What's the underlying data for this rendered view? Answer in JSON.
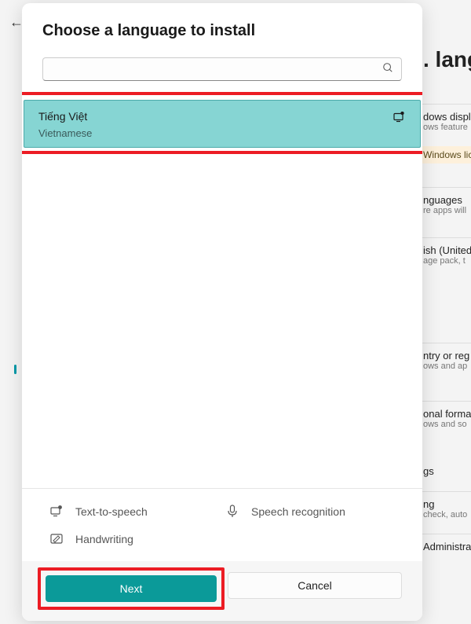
{
  "background": {
    "heading": ". lang",
    "items": [
      {
        "title": "dows displ",
        "sub": "ows feature"
      },
      {
        "title": "nguages",
        "sub": "re apps will"
      },
      {
        "title": "ish (United",
        "sub": "age pack, t"
      },
      {
        "title": "ntry or reg",
        "sub": "ows and ap"
      },
      {
        "title": "onal forma",
        "sub": "ows and so"
      },
      {
        "title": "gs",
        "sub": ""
      },
      {
        "title": "ng",
        "sub": "check, auto"
      },
      {
        "title": "Administrative",
        "sub": ""
      }
    ],
    "highlight": "Windows lic"
  },
  "dialog": {
    "title": "Choose a language to install",
    "search_placeholder": "",
    "selected": {
      "native": "Tiếng Việt",
      "english": "Vietnamese"
    },
    "features": {
      "tts": "Text-to-speech",
      "speech": "Speech recognition",
      "handwriting": "Handwriting"
    },
    "buttons": {
      "next": "Next",
      "cancel": "Cancel"
    }
  }
}
